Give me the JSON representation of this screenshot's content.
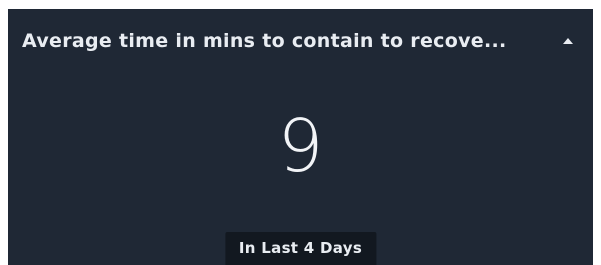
{
  "widget": {
    "title": "Average time in mins to contain to recove...",
    "collapse_icon": "caret-up-icon",
    "value": "9",
    "period_label": "In Last 4 Days"
  },
  "colors": {
    "card_background": "#1f2835",
    "badge_background": "#121820",
    "text": "#e9edf2"
  }
}
